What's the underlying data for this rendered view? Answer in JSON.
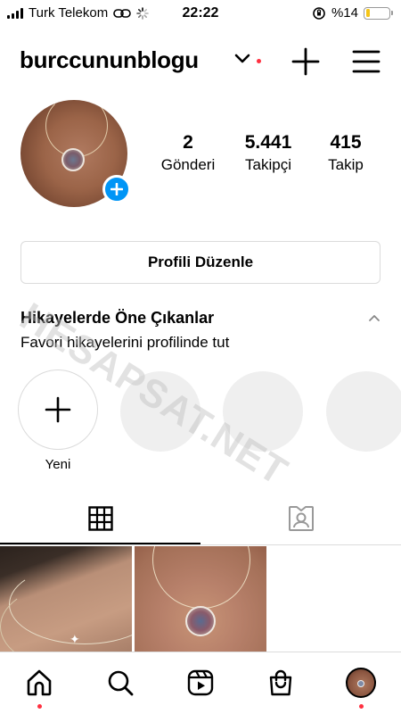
{
  "status_bar": {
    "carrier": "Turk Telekom",
    "time": "22:22",
    "battery_label": "%14",
    "battery_level": 0.14,
    "battery_color": "#f5c518"
  },
  "header": {
    "username": "burccunun blogu",
    "username_display": "burccunun blogu",
    "icons": [
      "chevron-down-icon",
      "plus-icon",
      "menu-icon"
    ],
    "notification_color": "#ff3040"
  },
  "profile": {
    "stats": [
      {
        "value": "2",
        "label": "Gönderi"
      },
      {
        "value": "5.441",
        "label": "Takipçi"
      },
      {
        "value": "415",
        "label": "Takip"
      }
    ],
    "add_badge_color": "#0095f6"
  },
  "edit_button": "Profili Düzenle",
  "highlights": {
    "title": "Hikayelerde Öne Çıkanlar",
    "subtitle": "Favori hikayelerini profilinde tut",
    "new_label": "Yeni"
  },
  "watermark": "HESAPSAT.NET",
  "tabs": [
    "grid-icon",
    "tagged-icon"
  ],
  "bottom_nav": [
    "home-icon",
    "search-icon",
    "reels-icon",
    "shop-icon",
    "profile-avatar"
  ]
}
